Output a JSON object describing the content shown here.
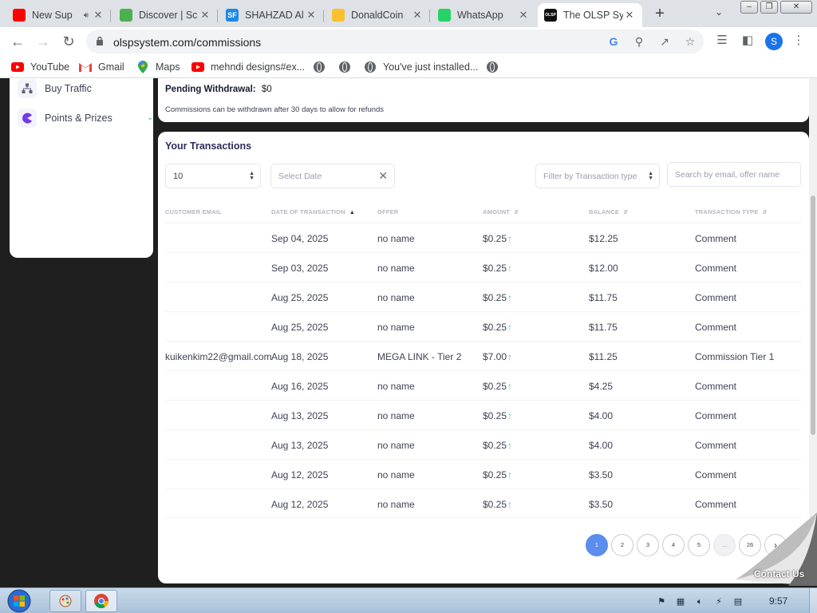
{
  "browser": {
    "tabs": [
      {
        "title": "New Sup",
        "icon": "youtube-icon",
        "color": "#ff0000",
        "muted": true
      },
      {
        "title": "Discover | Sc",
        "icon": "rocket-icon",
        "color": "#4caf50"
      },
      {
        "title": "SHAHZAD Al",
        "icon": "sf-icon",
        "glyph": "SF",
        "color": "#1e88e5"
      },
      {
        "title": "DonaldCoin",
        "icon": "donald-icon",
        "color": "#fbc02d"
      },
      {
        "title": "WhatsApp",
        "icon": "whatsapp-icon",
        "color": "#25d366"
      },
      {
        "title": "The OLSP Sy",
        "icon": "olsp-icon",
        "glyph": "OLSP",
        "color": "#111111",
        "active": true
      }
    ],
    "url": "olspsystem.com/commissions",
    "profile_initial": "S",
    "bookmarks": [
      {
        "label": "YouTube",
        "icon": "youtube-icon"
      },
      {
        "label": "Gmail",
        "icon": "gmail-icon"
      },
      {
        "label": "Maps",
        "icon": "maps-icon"
      },
      {
        "label": "mehndi designs#ex...",
        "icon": "youtube-icon"
      },
      {
        "label": "",
        "icon": "globe-icon"
      },
      {
        "label": "",
        "icon": "globe-icon"
      },
      {
        "label": "You've just installed...",
        "icon": "globe-icon"
      },
      {
        "label": "",
        "icon": "globe-icon"
      }
    ]
  },
  "sidebar": {
    "items": [
      {
        "label": "Buy Traffic",
        "icon": "network-icon"
      },
      {
        "label": "Points & Prizes",
        "icon": "pacman-icon"
      }
    ]
  },
  "summary": {
    "pending_label": "Pending Withdrawal:",
    "pending_value": "$0",
    "note": "Commissions can be withdrawn after 30 days to allow for refunds"
  },
  "transactions": {
    "title": "Your Transactions",
    "page_size": "10",
    "date_placeholder": "Select Date",
    "type_placeholder": "Filter by Transaction type",
    "search_placeholder": "Search by email, offer name",
    "columns": [
      "CUSTOMER EMAIL",
      "DATE OF TRANSACTION",
      "OFFER",
      "AMOUNT",
      "BALANCE",
      "TRANSACTION TYPE"
    ],
    "rows": [
      {
        "email": "",
        "date": "Sep 04, 2025",
        "offer": "no name",
        "amount": "$0.25",
        "balance": "$12.25",
        "type": "Comment"
      },
      {
        "email": "",
        "date": "Sep 03, 2025",
        "offer": "no name",
        "amount": "$0.25",
        "balance": "$12.00",
        "type": "Comment"
      },
      {
        "email": "",
        "date": "Aug 25, 2025",
        "offer": "no name",
        "amount": "$0.25",
        "balance": "$11.75",
        "type": "Comment"
      },
      {
        "email": "",
        "date": "Aug 25, 2025",
        "offer": "no name",
        "amount": "$0.25",
        "balance": "$11.75",
        "type": "Comment"
      },
      {
        "email": "kuikenkim22@gmail.com",
        "date": "Aug 18, 2025",
        "offer": "MEGA LINK - Tier 2",
        "amount": "$7.00",
        "balance": "$11.25",
        "type": "Commission Tier 1"
      },
      {
        "email": "",
        "date": "Aug 16, 2025",
        "offer": "no name",
        "amount": "$0.25",
        "balance": "$4.25",
        "type": "Comment"
      },
      {
        "email": "",
        "date": "Aug 13, 2025",
        "offer": "no name",
        "amount": "$0.25",
        "balance": "$4.00",
        "type": "Comment"
      },
      {
        "email": "",
        "date": "Aug 13, 2025",
        "offer": "no name",
        "amount": "$0.25",
        "balance": "$4.00",
        "type": "Comment"
      },
      {
        "email": "",
        "date": "Aug 12, 2025",
        "offer": "no name",
        "amount": "$0.25",
        "balance": "$3.50",
        "type": "Comment"
      },
      {
        "email": "",
        "date": "Aug 12, 2025",
        "offer": "no name",
        "amount": "$0.25",
        "balance": "$3.50",
        "type": "Comment"
      }
    ],
    "pages": [
      "1",
      "2",
      "3",
      "4",
      "5",
      "...",
      "26"
    ],
    "current_page": "1"
  },
  "contact_label": "Contact Us",
  "taskbar": {
    "clock": "9:57"
  },
  "colors": {
    "accent": "#5b8def",
    "positive": "#50cd89",
    "title": "#2b2e5a"
  }
}
